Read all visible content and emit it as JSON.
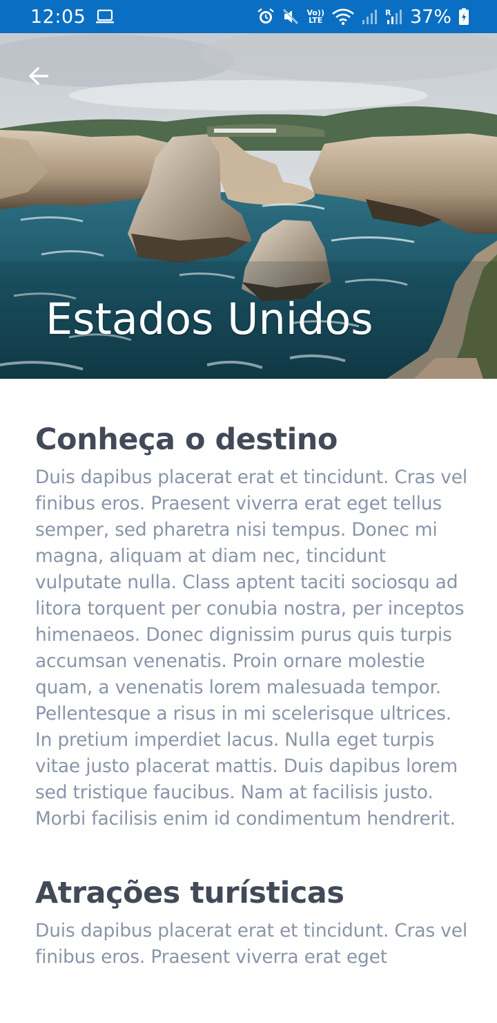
{
  "status_bar": {
    "time": "12:05",
    "battery": "37%",
    "icons": [
      "laptop-icon",
      "alarm-icon",
      "mute-icon",
      "volte-icon",
      "wifi-icon",
      "signal-icon",
      "signal-roaming-icon",
      "battery-charging-icon"
    ],
    "volte_label_top": "Vo))",
    "volte_label_bottom": "LTE"
  },
  "header": {
    "back_icon": "arrow-left-icon",
    "title": "Estados Unidos"
  },
  "sections": [
    {
      "title": "Conheça o destino",
      "body": "Duis dapibus placerat erat et tincidunt. Cras vel finibus eros. Praesent viverra erat eget tellus semper, sed pharetra nisi tempus. Donec mi magna, aliquam at diam nec, tincidunt vulputate nulla. Class aptent taciti sociosqu ad litora torquent per conubia nostra, per inceptos himenaeos. Donec dignissim purus quis turpis accumsan venenatis. Proin ornare molestie quam, a venenatis lorem malesuada tempor. Pellentesque a risus in mi scelerisque ultrices. In pretium imperdiet lacus. Nulla eget turpis vitae justo placerat mattis. Duis dapibus lorem sed tristique faucibus. Nam at facilisis justo. Morbi facilisis enim id condimentum hendrerit."
    },
    {
      "title": "Atrações turísticas",
      "body": "Duis dapibus placerat erat et tincidunt. Cras vel finibus eros. Praesent viverra erat eget"
    }
  ],
  "colors": {
    "status_bar": "#0a6fc2",
    "heading": "#424a58",
    "body_text": "#8a94a8",
    "background": "#ffffff"
  }
}
